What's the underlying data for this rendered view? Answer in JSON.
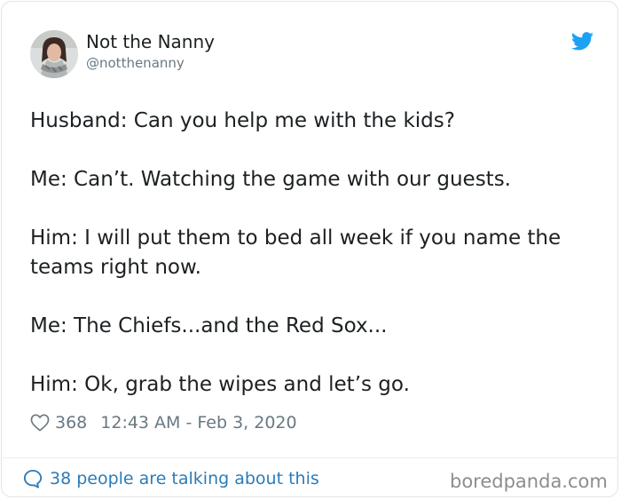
{
  "author": {
    "name": "Not the Nanny",
    "handle": "@notthenanny"
  },
  "icons": {
    "avatar": "profile-photo",
    "brand": "twitter-bird-icon",
    "like": "heart-outline-icon",
    "conversation": "speech-bubble-icon"
  },
  "tweet": {
    "lines": [
      "Husband: Can you help me with the kids?",
      "Me: Can’t. Watching the game with our guests.",
      "Him: I will put them to bed all week if you name the teams right now.",
      "Me: The Chiefs...and the Red Sox...",
      "Him: Ok, grab the wipes and let’s go."
    ],
    "likes": "368",
    "timestamp": "12:43 AM - Feb 3, 2020"
  },
  "footer": {
    "talking": "38 people are talking about this",
    "watermark": "boredpanda.com"
  },
  "colors": {
    "text": "#1c2022",
    "muted": "#697882",
    "link": "#2b7bb9",
    "twitter_blue": "#1da1f2",
    "border": "#dfe4e8"
  }
}
